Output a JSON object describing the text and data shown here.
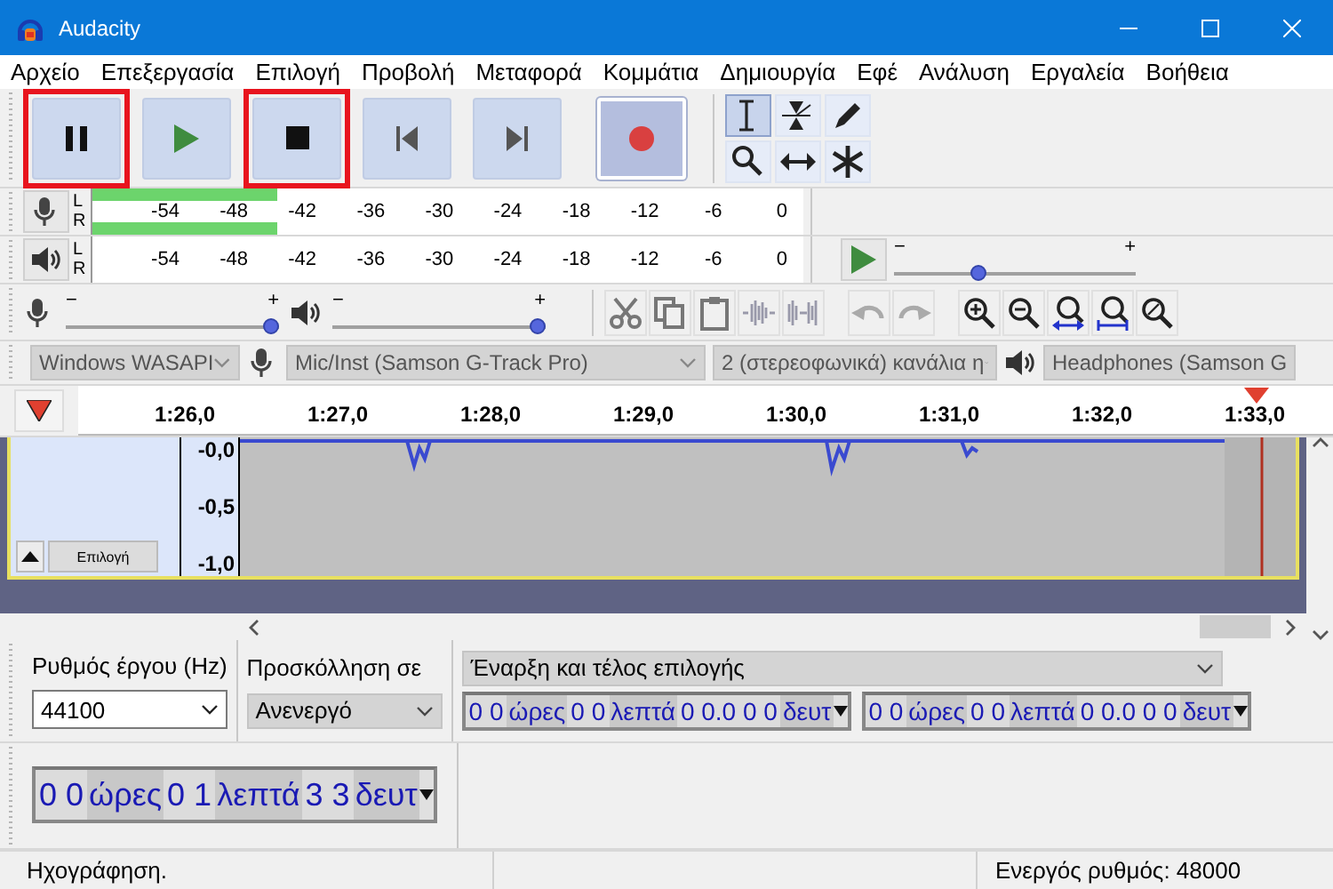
{
  "window": {
    "title": "Audacity"
  },
  "menu": [
    "Αρχείο",
    "Επεξεργασία",
    "Επιλογή",
    "Προβολή",
    "Μεταφορά",
    "Κομμάτια",
    "Δημιουργία",
    "Εφέ",
    "Ανάλυση",
    "Εργαλεία",
    "Βοήθεια"
  ],
  "transport": [
    {
      "kind": "pause",
      "highlighted": true
    },
    {
      "kind": "play",
      "highlighted": false
    },
    {
      "kind": "stop",
      "highlighted": true
    },
    {
      "kind": "skip_start",
      "highlighted": false
    },
    {
      "kind": "skip_end",
      "highlighted": false
    },
    {
      "kind": "record",
      "highlighted": false
    }
  ],
  "tools": [
    {
      "kind": "select",
      "selected": true
    },
    {
      "kind": "envelope",
      "selected": false
    },
    {
      "kind": "draw",
      "selected": false
    },
    {
      "kind": "zoom",
      "selected": false
    },
    {
      "kind": "timeshift",
      "selected": false
    },
    {
      "kind": "multi",
      "selected": false
    }
  ],
  "record_meter": {
    "channels": [
      {
        "label": "L",
        "level": 0.26
      },
      {
        "label": "R",
        "level": 0.26
      }
    ],
    "ticks": [
      "-54",
      "-48",
      "-42",
      "-36",
      "-30",
      "-24",
      "-18",
      "-12",
      "-6",
      "0"
    ]
  },
  "playback_meter": {
    "channels": [
      {
        "label": "L",
        "level": 0
      },
      {
        "label": "R",
        "level": 0
      }
    ],
    "ticks": [
      "-54",
      "-48",
      "-42",
      "-36",
      "-30",
      "-24",
      "-18",
      "-12",
      "-6",
      "0"
    ]
  },
  "play_at_speed": {
    "minus": "−",
    "plus": "+",
    "level": 0.34
  },
  "mixer": {
    "record": {
      "minus": "−",
      "plus": "+",
      "level": 1
    },
    "playback": {
      "minus": "−",
      "plus": "+",
      "level": 1
    }
  },
  "devices": {
    "host": "Windows WASAPI",
    "recording": "Mic/Inst (Samson G-Track Pro)",
    "channels": "2 (στερεοφωνικά) κανάλια η",
    "playback": "Headphones (Samson G"
  },
  "timeline": {
    "labels": [
      "1:26,0",
      "1:27,0",
      "1:28,0",
      "1:29,0",
      "1:30,0",
      "1:31,0",
      "1:32,0",
      "1:33,0"
    ]
  },
  "track": {
    "button": "Επιλογή",
    "scale": [
      "-0,0",
      "-0,5",
      "-1,0"
    ]
  },
  "selection_toolbar": {
    "rate_label": "Ρυθμός έργου (Hz)",
    "rate": "44100",
    "snap_label": "Προσκόλληση σε",
    "snap": "Ανενεργό",
    "mode": "Έναρξη και τέλος επιλογής",
    "start": [
      "0 0",
      "ώρες",
      "0 0",
      "λεπτά",
      "0 0.0 0 0",
      "δευτ"
    ],
    "end": [
      "0 0",
      "ώρες",
      "0 0",
      "λεπτά",
      "0 0.0 0 0",
      "δευτ"
    ]
  },
  "time_toolbar": {
    "time": [
      "0 0",
      "ώρες",
      "0 1",
      "λεπτά",
      "3 3",
      "δευτ"
    ]
  },
  "status_bar": {
    "state": "Ηχογράφηση.",
    "rate": "Ενεργός ρυθμός: 48000"
  }
}
